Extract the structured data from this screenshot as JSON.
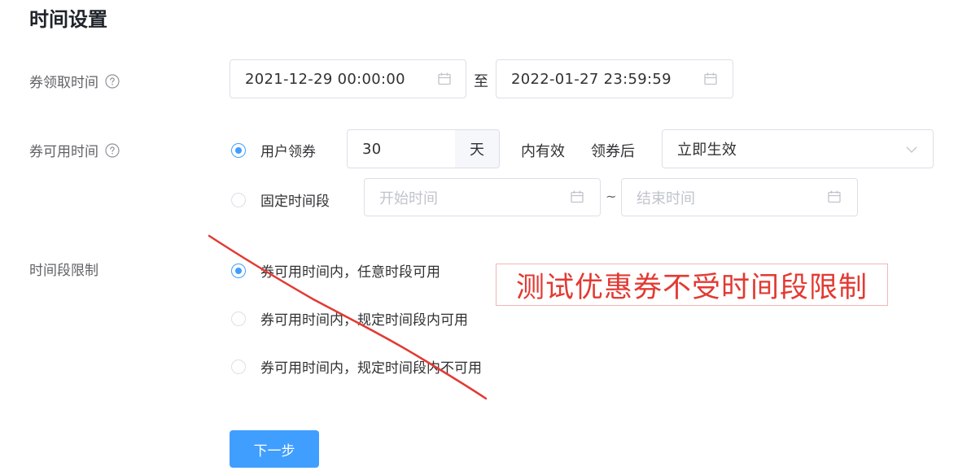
{
  "section_title": "时间设置",
  "claim_time": {
    "label": "券领取时间",
    "start_value": "2021-12-29 00:00:00",
    "separator": "至",
    "end_value": "2022-01-27 23:59:59"
  },
  "usable_time": {
    "label": "券可用时间",
    "option_user": {
      "label": "用户领券",
      "selected": true,
      "days_value": "30",
      "days_unit": "天",
      "suffix": "内有效",
      "after_label": "领券后",
      "effective_select": "立即生效"
    },
    "option_fixed": {
      "label": "固定时间段",
      "selected": false,
      "start_placeholder": "开始时间",
      "range_separator": "~",
      "end_placeholder": "结束时间"
    }
  },
  "period_limit": {
    "label": "时间段限制",
    "options": [
      {
        "label": "券可用时间内，任意时段可用",
        "selected": true
      },
      {
        "label": "券可用时间内，规定时间段内可用",
        "selected": false
      },
      {
        "label": "券可用时间内，规定时间段内不可用",
        "selected": false
      }
    ]
  },
  "next_button": "下一步",
  "annotation": {
    "text": "测试优惠券不受时间段限制",
    "color": "#e23a33"
  },
  "colors": {
    "primary": "#409eff",
    "annotation_red": "#e23a33"
  },
  "icons": [
    "help-circle-icon",
    "calendar-icon",
    "chevron-down-icon"
  ]
}
